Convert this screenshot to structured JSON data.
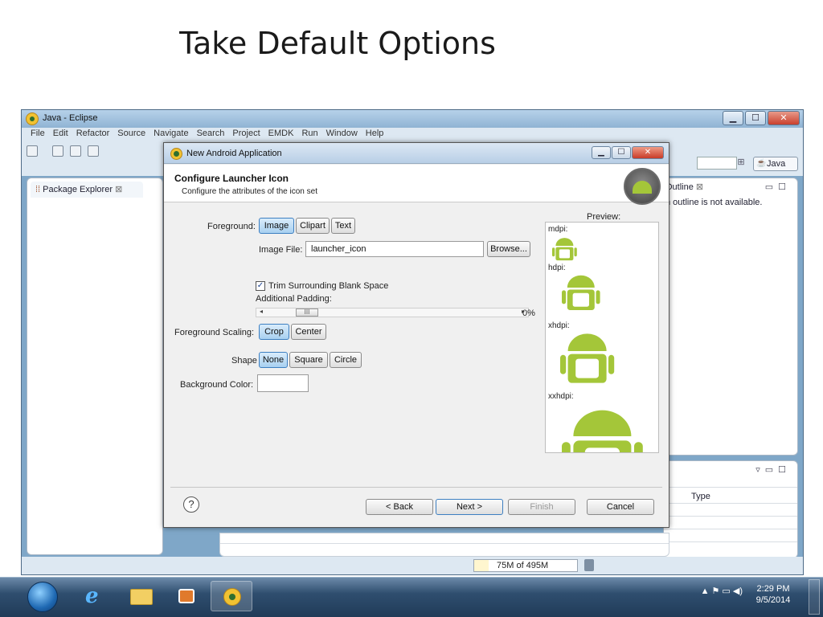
{
  "slide": {
    "title": "Take Default Options"
  },
  "eclipse": {
    "title": "Java - Eclipse",
    "menu": [
      "File",
      "Edit",
      "Refactor",
      "Source",
      "Navigate",
      "Search",
      "Project",
      "EMDK",
      "Run",
      "Window",
      "Help"
    ],
    "perspective_label": "Java",
    "package_explorer_tab": "Package Explorer",
    "outline_tab": "Outline",
    "outline_message": "n outline is not available.",
    "type_column": "Type",
    "memory": "75M of 495M"
  },
  "dialog": {
    "title": "New Android Application",
    "header_title": "Configure Launcher Icon",
    "header_subtitle": "Configure the attributes of the icon set",
    "foreground_label": "Foreground:",
    "foreground_options": [
      "Image",
      "Clipart",
      "Text"
    ],
    "image_file_label": "Image File:",
    "image_file_value": "launcher_icon",
    "browse_label": "Browse...",
    "trim_label": "Trim Surrounding Blank Space",
    "trim_checked": true,
    "padding_label": "Additional Padding:",
    "padding_value": "0%",
    "scaling_label": "Foreground Scaling:",
    "scaling_options": [
      "Crop",
      "Center"
    ],
    "shape_label": "Shape",
    "shape_options": [
      "None",
      "Square",
      "Circle"
    ],
    "bg_color_label": "Background Color:",
    "preview_label": "Preview:",
    "densities": [
      "mdpi:",
      "hdpi:",
      "xhdpi:",
      "xxhdpi:"
    ],
    "back_label": "< Back",
    "next_label": "Next >",
    "finish_label": "Finish",
    "cancel_label": "Cancel"
  },
  "taskbar": {
    "time": "2:29 PM",
    "date": "9/5/2014"
  },
  "colors": {
    "android_green": "#a4c639",
    "selected_button": "#a8d0f0"
  }
}
